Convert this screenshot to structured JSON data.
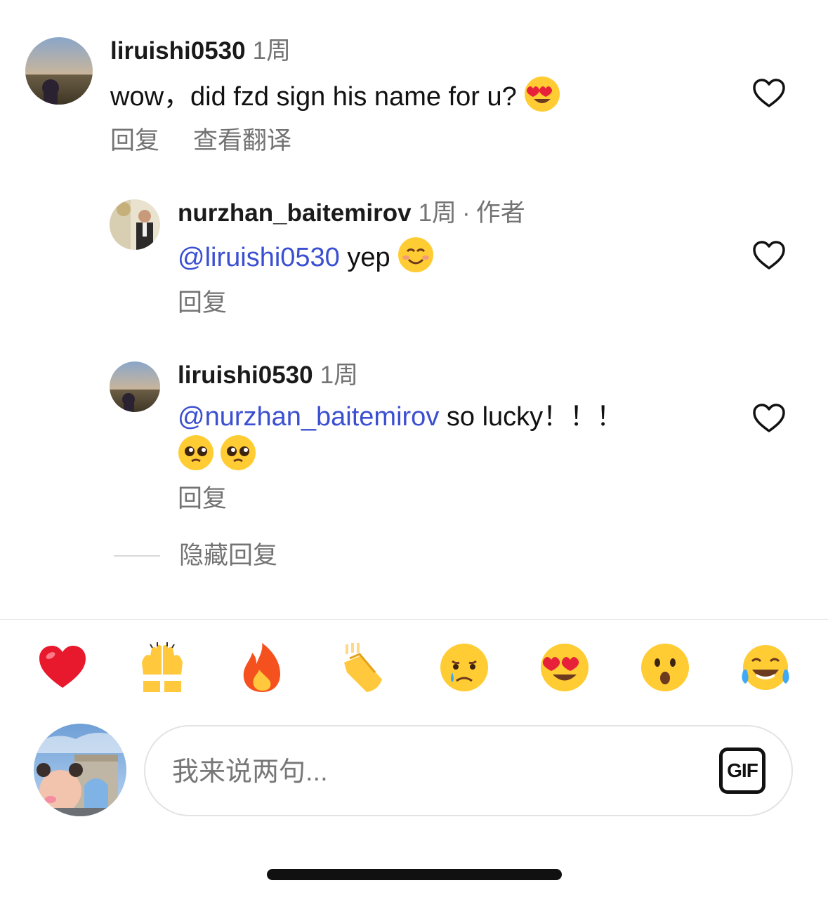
{
  "comments": [
    {
      "username": "liruishi0530",
      "time": "1周",
      "text": "wow，did fzd sign his name for u?",
      "actions": {
        "reply": "回复",
        "translate": "查看翻译"
      }
    },
    {
      "username": "nurzhan_baitemirov",
      "time": "1周",
      "author_tag": "作者",
      "mention": "@liruishi0530",
      "text": "yep",
      "actions": {
        "reply": "回复"
      }
    },
    {
      "username": "liruishi0530",
      "time": "1周",
      "mention": "@nurzhan_baitemirov",
      "text": "so lucky！！！",
      "actions": {
        "reply": "回复"
      }
    }
  ],
  "hide_replies": "隐藏回复",
  "quick_reactions": [
    "red-heart",
    "raising-hands",
    "fire",
    "clapping-hands",
    "crying-face",
    "heart-eyes",
    "surprised-face",
    "tears-of-joy"
  ],
  "composer": {
    "placeholder": "我来说两句...",
    "gif_label": "GIF"
  },
  "colors": {
    "mention": "#3b4fd1",
    "secondary_text": "#737373",
    "heart_outline": "#111111"
  }
}
